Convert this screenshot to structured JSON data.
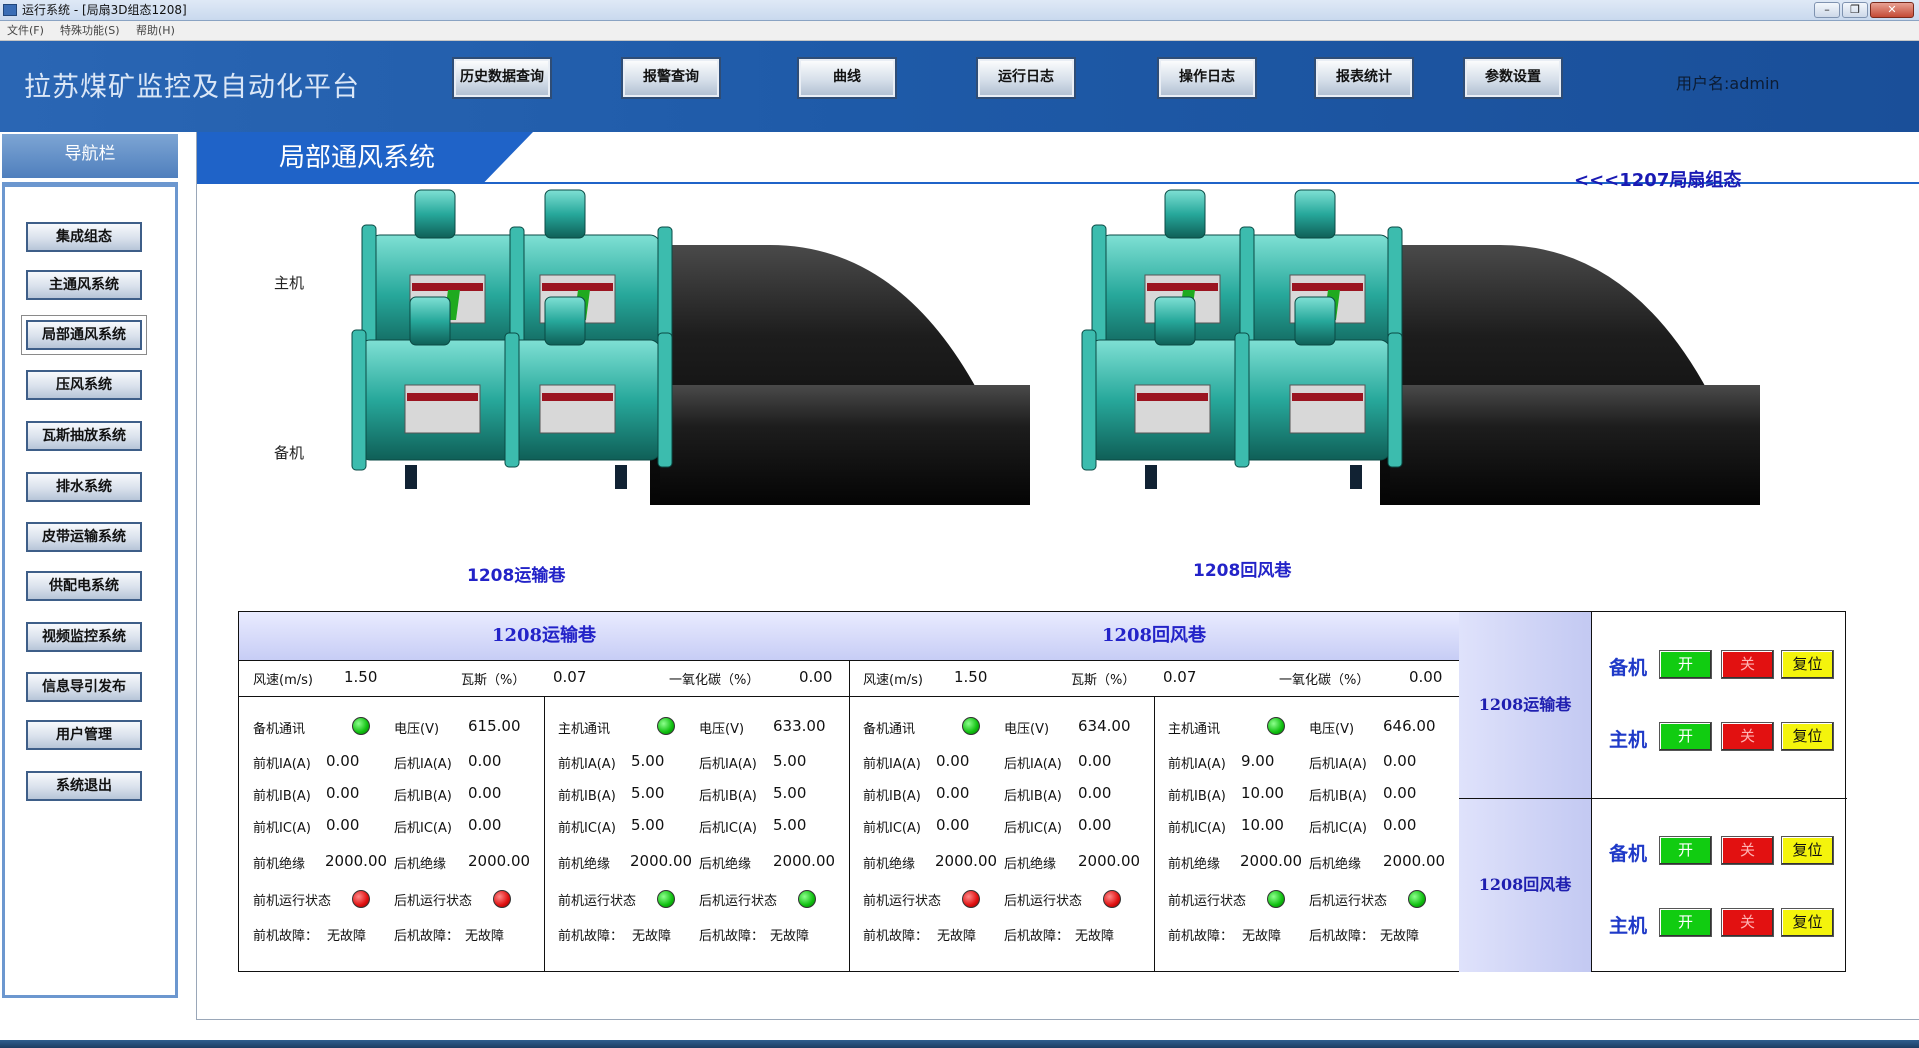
{
  "window": {
    "title": "运行系统 - [局扇3D组态1208]"
  },
  "menu": [
    "文件(F)",
    "特殊功能(S)",
    "帮助(H)"
  ],
  "header": {
    "app_title": "拉苏煤矿监控及自动化平台",
    "user": "用户名:admin",
    "buttons": [
      "历史数据查询",
      "报警查询",
      "曲线",
      "运行日志",
      "操作日志",
      "报表统计",
      "参数设置"
    ]
  },
  "nav": {
    "title": "导航栏",
    "items": [
      "集成组态",
      "主通风系统",
      "局部通风系统",
      "压风系统",
      "瓦斯抽放系统",
      "排水系统",
      "皮带运输系统",
      "供配电系统",
      "视频监控系统",
      "信息导引发布",
      "用户管理",
      "系统退出"
    ],
    "active_index": 2
  },
  "page": {
    "title": "局部通风系统",
    "link": "<<<1207局扇组态",
    "row_main": "主机",
    "row_backup": "备机",
    "group_left": "1208运输巷",
    "group_right": "1208回风巷"
  },
  "sections": [
    {
      "title": "1208运输巷",
      "env": [
        {
          "label": "风速(m/s)",
          "value": "1.50"
        },
        {
          "label": "瓦斯（%）",
          "value": "0.07"
        },
        {
          "label": "一氧化碳（%）",
          "value": "0.00"
        }
      ],
      "cols": [
        {
          "comm_label": "备机通讯",
          "comm_led": "green",
          "volt_label": "电压(V)",
          "volt": "615.00",
          "rows": [
            [
              "前机IA(A)",
              "0.00",
              "后机IA(A)",
              "0.00"
            ],
            [
              "前机IB(A)",
              "0.00",
              "后机IB(A)",
              "0.00"
            ],
            [
              "前机IC(A)",
              "0.00",
              "后机IC(A)",
              "0.00"
            ],
            [
              "前机绝缘",
              "2000.00",
              "后机绝缘",
              "2000.00"
            ]
          ],
          "run": [
            "前机运行状态",
            "red",
            "后机运行状态",
            "red"
          ],
          "fault": [
            "前机故障：",
            "无故障",
            "后机故障：",
            "无故障"
          ]
        },
        {
          "comm_label": "主机通讯",
          "comm_led": "green",
          "volt_label": "电压(V)",
          "volt": "633.00",
          "rows": [
            [
              "前机IA(A)",
              "5.00",
              "后机IA(A)",
              "5.00"
            ],
            [
              "前机IB(A)",
              "5.00",
              "后机IB(A)",
              "5.00"
            ],
            [
              "前机IC(A)",
              "5.00",
              "后机IC(A)",
              "5.00"
            ],
            [
              "前机绝缘",
              "2000.00",
              "后机绝缘",
              "2000.00"
            ]
          ],
          "run": [
            "前机运行状态",
            "green",
            "后机运行状态",
            "green"
          ],
          "fault": [
            "前机故障：",
            "无故障",
            "后机故障：",
            "无故障"
          ]
        }
      ]
    },
    {
      "title": "1208回风巷",
      "env": [
        {
          "label": "风速(m/s)",
          "value": "1.50"
        },
        {
          "label": "瓦斯（%）",
          "value": "0.07"
        },
        {
          "label": "一氧化碳（%）",
          "value": "0.00"
        }
      ],
      "cols": [
        {
          "comm_label": "备机通讯",
          "comm_led": "green",
          "volt_label": "电压(V)",
          "volt": "634.00",
          "rows": [
            [
              "前机IA(A)",
              "0.00",
              "后机IA(A)",
              "0.00"
            ],
            [
              "前机IB(A)",
              "0.00",
              "后机IB(A)",
              "0.00"
            ],
            [
              "前机IC(A)",
              "0.00",
              "后机IC(A)",
              "0.00"
            ],
            [
              "前机绝缘",
              "2000.00",
              "后机绝缘",
              "2000.00"
            ]
          ],
          "run": [
            "前机运行状态",
            "red",
            "后机运行状态",
            "red"
          ],
          "fault": [
            "前机故障：",
            "无故障",
            "后机故障：",
            "无故障"
          ]
        },
        {
          "comm_label": "主机通讯",
          "comm_led": "green",
          "volt_label": "电压(V)",
          "volt": "646.00",
          "rows": [
            [
              "前机IA(A)",
              "9.00",
              "后机IA(A)",
              "0.00"
            ],
            [
              "前机IB(A)",
              "10.00",
              "后机IB(A)",
              "0.00"
            ],
            [
              "前机IC(A)",
              "10.00",
              "后机IC(A)",
              "0.00"
            ],
            [
              "前机绝缘",
              "2000.00",
              "后机绝缘",
              "2000.00"
            ]
          ],
          "run": [
            "前机运行状态",
            "green",
            "后机运行状态",
            "green"
          ],
          "fault": [
            "前机故障：",
            "无故障",
            "后机故障：",
            "无故障"
          ]
        }
      ]
    }
  ],
  "controls": [
    {
      "name": "1208运输巷",
      "rows": [
        {
          "label": "备机"
        },
        {
          "label": "主机"
        }
      ]
    },
    {
      "name": "1208回风巷",
      "rows": [
        {
          "label": "备机"
        },
        {
          "label": "主机"
        }
      ]
    }
  ],
  "control_buttons": {
    "on": "开",
    "off": "关",
    "reset": "复位"
  },
  "colors": {
    "header_blue": "#1e5aa8",
    "fan_teal": "#2aa79d",
    "led_green": "#0fbf0f",
    "led_red": "#e01010"
  }
}
